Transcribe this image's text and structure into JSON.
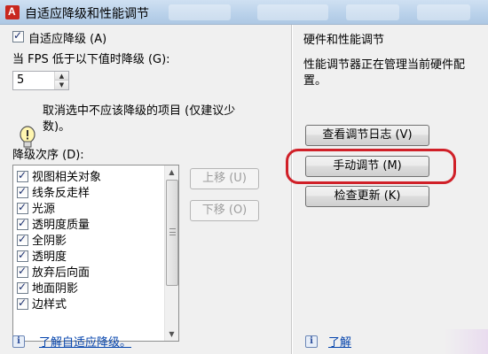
{
  "window": {
    "title": "自适应降级和性能调节"
  },
  "left": {
    "adaptive_checkbox_label": "自适应降级 (A)",
    "fps_label": "当 FPS 低于以下值时降级 (G):",
    "fps_value": "5",
    "tip_line1": "取消选中不应该降级的项目 (仅建议少",
    "tip_line2": "数)。",
    "order_label": "降级次序 (D):",
    "items": [
      {
        "label": "视图相关对象",
        "checked": true
      },
      {
        "label": "线条反走样",
        "checked": true
      },
      {
        "label": "光源",
        "checked": true
      },
      {
        "label": "透明度质量",
        "checked": true
      },
      {
        "label": "全阴影",
        "checked": true
      },
      {
        "label": "透明度",
        "checked": true
      },
      {
        "label": "放弃后向面",
        "checked": true
      },
      {
        "label": "地面阴影",
        "checked": true
      },
      {
        "label": "边样式",
        "checked": true
      }
    ],
    "move_up_label": "上移 (U)",
    "move_down_label": "下移 (O)",
    "learn_link": "了解自适应降级。"
  },
  "right": {
    "heading": "硬件和性能调节",
    "status_line1": "性能调节器正在管理当前硬件配",
    "status_line2": "置。",
    "view_log_label": "查看调节日志 (V)",
    "manual_tune_label": "手动调节 (M)",
    "check_updates_label": "检查更新 (K)",
    "learn_link": "了解"
  },
  "colors": {
    "highlight": "#d02028",
    "link": "#0645ad"
  }
}
